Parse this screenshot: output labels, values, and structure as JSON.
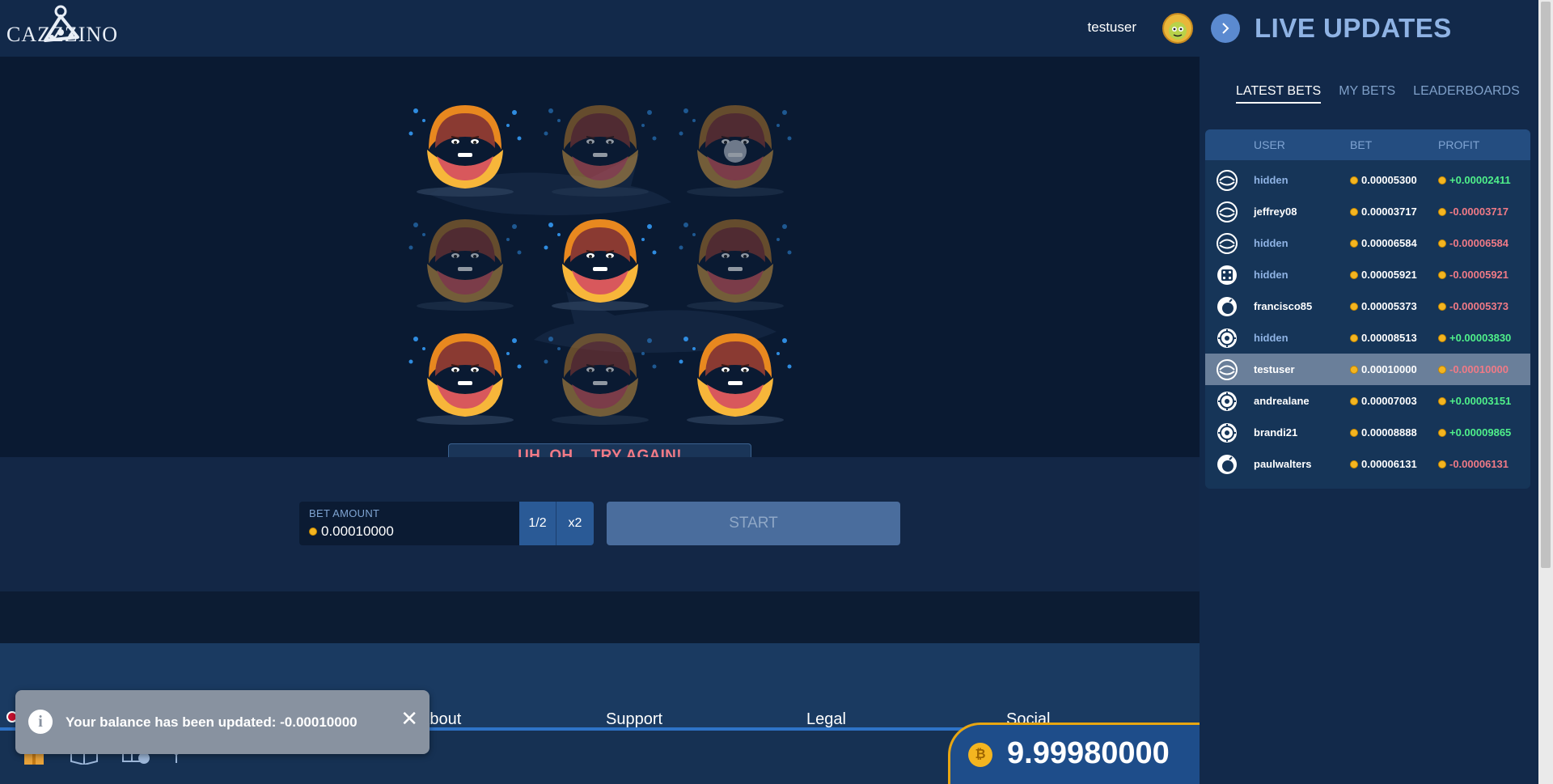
{
  "header": {
    "logo_text": "CAZZZINO",
    "username": "testuser"
  },
  "game": {
    "result_message": "UH, OH... TRY AGAIN!"
  },
  "controls": {
    "bet_label": "BET AMOUNT",
    "bet_value": "0.00010000",
    "half_label": "1/2",
    "double_label": "x2",
    "start_label": "START"
  },
  "footer": {
    "columns": [
      "About",
      "Support",
      "Legal",
      "Social"
    ],
    "balance": "9.99980000"
  },
  "toast": {
    "message": "Your balance has been updated: -0.00010000",
    "close": "✕",
    "icon": "i"
  },
  "sidebar": {
    "title": "LIVE UPDATES",
    "tabs": [
      "LATEST BETS",
      "MY BETS",
      "LEADERBOARDS"
    ],
    "columns": {
      "user": "USER",
      "bet": "BET",
      "profit": "PROFIT"
    },
    "rows": [
      {
        "icon": "clam-icon",
        "user": "hidden",
        "bet": "0.00005300",
        "profit": "+0.00002411"
      },
      {
        "icon": "clam-icon",
        "user": "jeffrey08",
        "bet": "0.00003717",
        "profit": "-0.00003717"
      },
      {
        "icon": "clam-icon",
        "user": "hidden",
        "bet": "0.00006584",
        "profit": "-0.00006584"
      },
      {
        "icon": "dice-icon",
        "user": "hidden",
        "bet": "0.00005921",
        "profit": "-0.00005921"
      },
      {
        "icon": "bomb-icon",
        "user": "francisco85",
        "bet": "0.00005373",
        "profit": "-0.00005373"
      },
      {
        "icon": "ball-icon",
        "user": "hidden",
        "bet": "0.00008513",
        "profit": "+0.00003830"
      },
      {
        "icon": "clam-icon",
        "user": "testuser",
        "bet": "0.00010000",
        "profit": "-0.00010000"
      },
      {
        "icon": "ball-icon",
        "user": "andrealane",
        "bet": "0.00007003",
        "profit": "+0.00003151"
      },
      {
        "icon": "ball-icon",
        "user": "brandi21",
        "bet": "0.00008888",
        "profit": "+0.00009865"
      },
      {
        "icon": "bomb-icon",
        "user": "paulwalters",
        "bet": "0.00006131",
        "profit": "-0.00006131"
      }
    ]
  },
  "colors": {
    "accent": "#2e73c7",
    "loss": "#f07a86",
    "win": "#4ff08a",
    "coin": "#f4b520"
  }
}
